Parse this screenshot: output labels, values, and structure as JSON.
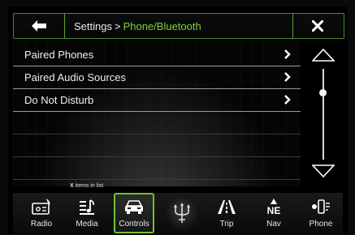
{
  "header": {
    "breadcrumb_parent": "Settings",
    "breadcrumb_separator": ">",
    "breadcrumb_current": "Phone/Bluetooth",
    "back_icon": "left-arrow-icon",
    "close_icon": "close-icon"
  },
  "list": {
    "items": [
      {
        "label": "Paired Phones"
      },
      {
        "label": "Paired Audio Sources"
      },
      {
        "label": "Do Not Disturb"
      }
    ],
    "count_prefix": "X",
    "count_suffix": "items in list"
  },
  "nav": {
    "items": [
      {
        "label": "Radio",
        "icon": "radio-icon"
      },
      {
        "label": "Media",
        "icon": "media-icon"
      },
      {
        "label": "Controls",
        "icon": "car-icon",
        "active": true
      },
      {
        "label": "Trip",
        "icon": "road-icon"
      },
      {
        "label": "Nav",
        "icon": "compass-ne-icon",
        "compass": "NE"
      },
      {
        "label": "Phone",
        "icon": "phone-icon"
      }
    ],
    "logo_icon": "trident-logo-icon"
  },
  "colors": {
    "accent": "#6fc231",
    "breadcrumb_current": "#7ed339",
    "text": "#f0f0f0",
    "background": "#000000"
  }
}
